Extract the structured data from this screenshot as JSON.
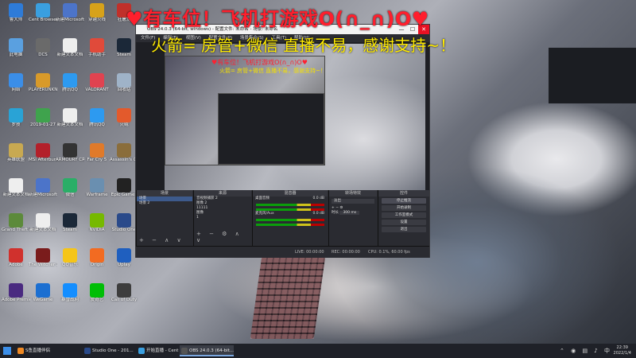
{
  "overlay": {
    "line1": "♥有车位！飞机打游戏O(∩_∩)O♥",
    "line2": "火箭= 房管+微信 直播不易，感谢支持~！"
  },
  "desktop_icons": [
    {
      "label": "鲁大师",
      "color": "#2e7bd8"
    },
    {
      "label": "Cent Browser",
      "color": "#3a9fe0"
    },
    {
      "label": "新建Microsoft",
      "color": "#4c74c9"
    },
    {
      "label": "穿越火线",
      "color": "#d7a21a"
    },
    {
      "label": "狂屠龙",
      "color": "#c0302a"
    },
    {
      "label": "此电脑",
      "color": "#5aa0e0"
    },
    {
      "label": "DCS",
      "color": "#6a6a6a"
    },
    {
      "label": "新建文本文档",
      "color": "#eeeeee"
    },
    {
      "label": "手机助手",
      "color": "#e04a3a"
    },
    {
      "label": "Steam",
      "color": "#1b2838"
    },
    {
      "label": "网络",
      "color": "#3b8ee8"
    },
    {
      "label": "PLAYERUNKNOWN'S",
      "color": "#d89a2a"
    },
    {
      "label": "腾讯QQ",
      "color": "#2d9af0"
    },
    {
      "label": "VALORANT",
      "color": "#e04350"
    },
    {
      "label": "回收站",
      "color": "#9fb3c8"
    },
    {
      "label": "罗技",
      "color": "#29a3d6"
    },
    {
      "label": "2019-01-27",
      "color": "#3fa34d"
    },
    {
      "label": "新建文本文档",
      "color": "#eeeeee"
    },
    {
      "label": "腾讯QQ",
      "color": "#2d9af0"
    },
    {
      "label": "火绒",
      "color": "#e35a2c"
    },
    {
      "label": "英雄联盟",
      "color": "#c8a951"
    },
    {
      "label": "MSI Afterburner",
      "color": "#b3202a"
    },
    {
      "label": "ARMOURY CRATE",
      "color": "#333333"
    },
    {
      "label": "Far Cry 5",
      "color": "#e07a2a"
    },
    {
      "label": "Assassin's Creed O...",
      "color": "#8a6d3b"
    },
    {
      "label": "新建文本文档",
      "color": "#eeeeee"
    },
    {
      "label": "新建Microsoft",
      "color": "#4c74c9"
    },
    {
      "label": "微信",
      "color": "#2aae67"
    },
    {
      "label": "Warframe",
      "color": "#6a8fb0"
    },
    {
      "label": "Epic Games",
      "color": "#222222"
    },
    {
      "label": "Grand Theft Auto V",
      "color": "#5c8a3a"
    },
    {
      "label": "新建文本文档",
      "color": "#eeeeee"
    },
    {
      "label": "Steam",
      "color": "#1b2838"
    },
    {
      "label": "NVIDIA",
      "color": "#76b900"
    },
    {
      "label": "Studio One",
      "color": "#2a4a8a"
    },
    {
      "label": "Adobe",
      "color": "#d0312d"
    },
    {
      "label": "The Witcher 3",
      "color": "#7a1c1c"
    },
    {
      "label": "QQ音乐",
      "color": "#f5c518"
    },
    {
      "label": "Origin",
      "color": "#f26b21"
    },
    {
      "label": "Uplay",
      "color": "#1f5fbf"
    },
    {
      "label": "Adobe Premiere",
      "color": "#4a2a80"
    },
    {
      "label": "WeGame",
      "color": "#1c6fd1"
    },
    {
      "label": "暴雪战网",
      "color": "#148eff"
    },
    {
      "label": "爱奇艺",
      "color": "#00be06"
    },
    {
      "label": "Call of Duty",
      "color": "#3d3d3d"
    }
  ],
  "obs": {
    "title": "OBS 24.0.3 (64-bit, windows) - 配置文件: 未命名 - 场景: 未命名",
    "minimize": "—",
    "maximize": "☐",
    "close": "✕",
    "menu": [
      "文件(F)",
      "编辑(E)",
      "视图(V)",
      "配置文件(P)",
      "场景集合(S)",
      "工具(T)",
      "帮助(H)"
    ],
    "docks": {
      "scenes": {
        "title": "场景",
        "items": [
          "场景",
          "场景 2"
        ]
      },
      "sources": {
        "title": "来源",
        "items": [
          "音视频捕获 2",
          "图像 2",
          "11111",
          "图像",
          "1"
        ]
      },
      "mixer": {
        "title": "混音器",
        "items": [
          "桌面音频",
          "0.0 dB",
          "麦克风/Aux",
          "0.0 dB"
        ]
      },
      "transitions": {
        "title": "转场特效",
        "type": "淡出",
        "duration_label": "时长",
        "duration": "300 ms"
      },
      "controls": {
        "title": "控件",
        "buttons": [
          "停止推流",
          "开始录制",
          "工作室模式",
          "设置",
          "退出"
        ]
      }
    },
    "status": {
      "live": "LIVE: 00:00:00",
      "rec": "REC: 00:00:00",
      "cpu": "CPU: 0.1%, 60.00 fps"
    }
  },
  "taskbar": {
    "apps": [
      {
        "label": "S鱼直播伴侣",
        "color": "#f08a24",
        "active": false
      },
      {
        "label": "Studio One - 201...",
        "color": "#2a4a8a",
        "active": false
      },
      {
        "label": "开始直播 - Cent B...",
        "color": "#3a9fe0",
        "active": false
      },
      {
        "label": "OBS 24.0.3 (64-bit...",
        "color": "#555555",
        "active": true
      }
    ],
    "time": "22:39",
    "date": "2022/1/4"
  }
}
